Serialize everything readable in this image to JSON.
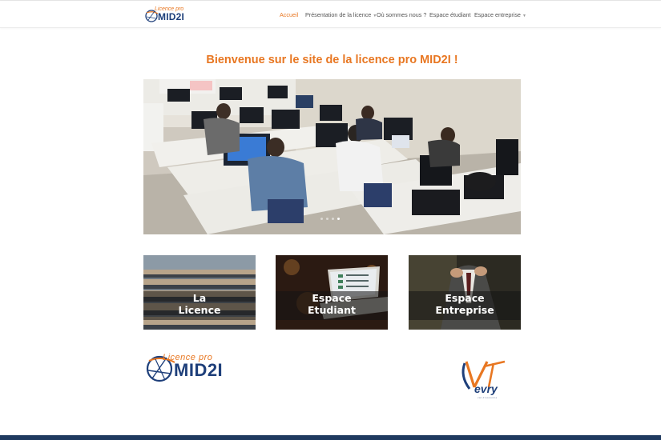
{
  "header": {
    "logo": {
      "line1": "Licence pro",
      "line2": "MID2I"
    },
    "nav": [
      {
        "label": "Accueil",
        "active": true,
        "has_dropdown": false
      },
      {
        "label": "Présentation de la licence",
        "active": false,
        "has_dropdown": true
      },
      {
        "label": "Où sommes nous ?",
        "active": false,
        "has_dropdown": false
      },
      {
        "label": "Espace étudiant",
        "active": false,
        "has_dropdown": false
      },
      {
        "label": "Espace entreprise",
        "active": false,
        "has_dropdown": true
      }
    ]
  },
  "main": {
    "welcome": "Bienvenue sur le site de la licence pro MID2I !",
    "slider": {
      "slide_count": 4,
      "active_slide": 4
    },
    "cards": [
      {
        "label_line1": "La",
        "label_line2": "Licence"
      },
      {
        "label_line1": "Espace",
        "label_line2": "Etudiant"
      },
      {
        "label_line1": "Espace",
        "label_line2": "Entreprise"
      }
    ]
  },
  "footer_logos": {
    "mid2i": {
      "line1": "Licence pro",
      "line2": "MID2I"
    },
    "evry": {
      "name": "evry",
      "sub": "val d'essonne"
    }
  },
  "colors": {
    "accent": "#e87722",
    "brand_blue": "#1e3f7a",
    "footer": "#1f3a5f"
  }
}
